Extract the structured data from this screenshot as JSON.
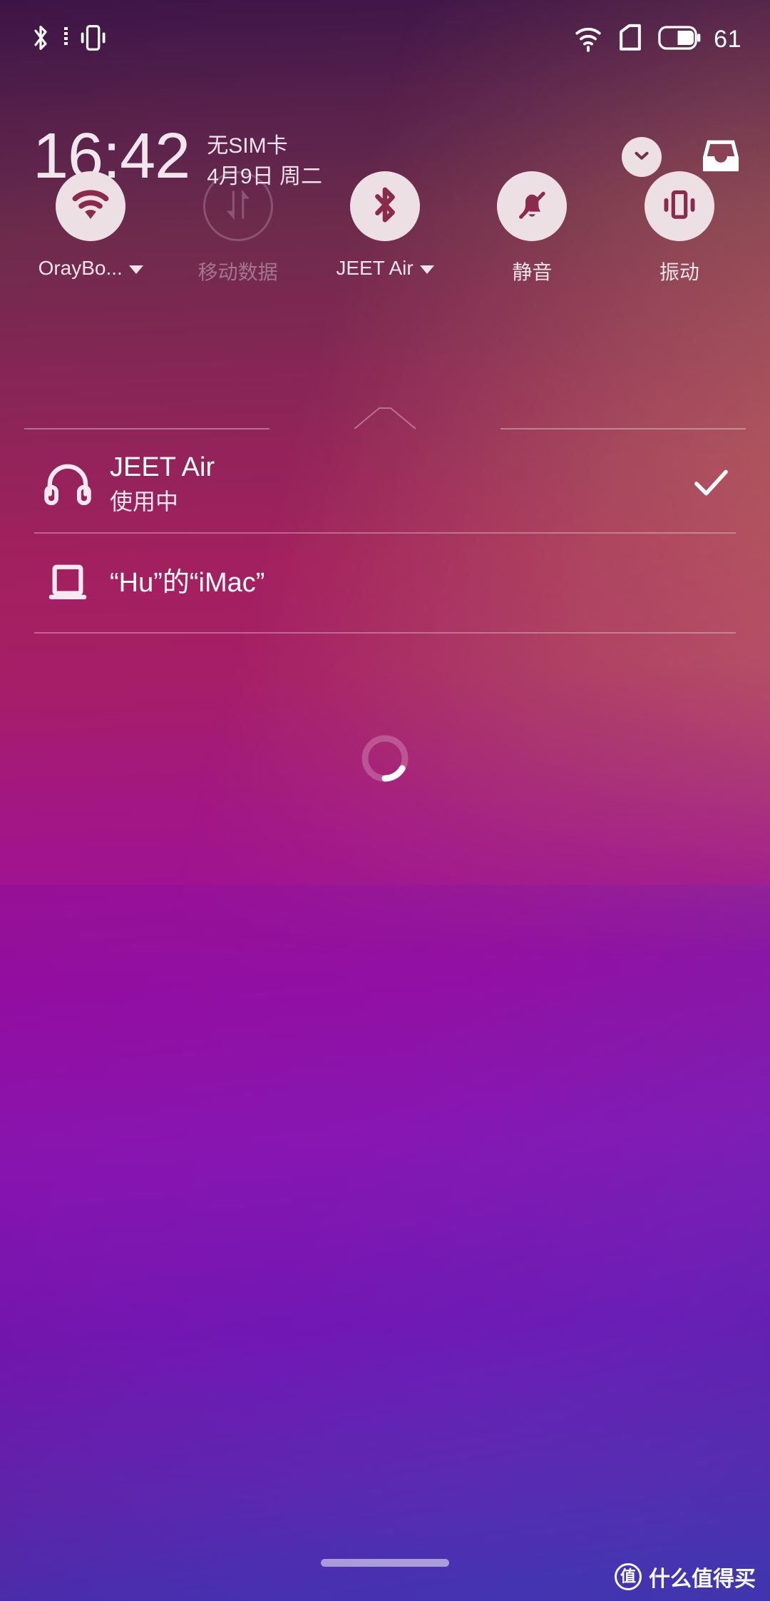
{
  "theme": {
    "accent_light": "#ece0e4",
    "text_primary": "#ffffff",
    "text_secondary": "#f0e4ea",
    "gradient_top": "#3f1549",
    "gradient_mid": "#a3205f",
    "gradient_bottom": "#4438b8"
  },
  "status_bar": {
    "bluetooth_icon": "bluetooth-icon",
    "vibrate_icon": "vibrate-icon",
    "wifi_icon": "wifi-icon",
    "sim_icon": "sim-card-icon",
    "battery_icon": "battery-icon",
    "battery_level": "61"
  },
  "header": {
    "time": "16:42",
    "carrier": "无SIM卡",
    "date": "4月9日 周二",
    "expand_button": "chevron-down-icon",
    "inbox_button": "inbox-icon"
  },
  "quick_settings": {
    "tiles": [
      {
        "id": "wifi",
        "icon": "wifi-icon",
        "label": "OrayBo...",
        "has_caret": true,
        "enabled": true
      },
      {
        "id": "data",
        "icon": "mobile-data-icon",
        "label": "移动数据",
        "has_caret": false,
        "enabled": false
      },
      {
        "id": "bluetooth",
        "icon": "bluetooth-icon",
        "label": "JEET Air",
        "has_caret": true,
        "enabled": true
      },
      {
        "id": "silent",
        "icon": "bell-off-icon",
        "label": "静音",
        "has_caret": false,
        "enabled": true
      },
      {
        "id": "vibrate",
        "icon": "vibrate-icon",
        "label": "振动",
        "has_caret": false,
        "enabled": true
      }
    ]
  },
  "bluetooth_panel": {
    "devices": [
      {
        "icon": "headphones-icon",
        "name": "JEET Air",
        "status": "使用中",
        "connected": true
      },
      {
        "icon": "laptop-icon",
        "name": "“Hu”的“iMac”",
        "status": "",
        "connected": false
      }
    ],
    "scanning": true,
    "spinner": "loading-spinner"
  },
  "system": {
    "home_indicator": "home-indicator"
  },
  "watermark": {
    "logo_char": "值",
    "text": "什么值得买"
  }
}
